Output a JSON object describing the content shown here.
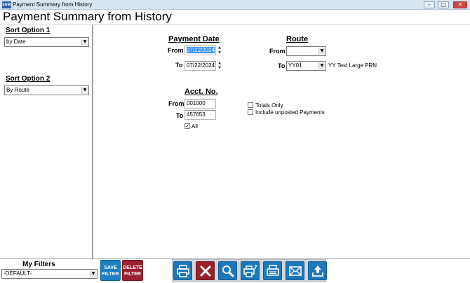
{
  "window": {
    "title": "Payment Summary from History",
    "app_icon": "ssw"
  },
  "page_title": "Payment Summary from History",
  "sort_option_1": {
    "label": "Sort Option 1",
    "value": "by Date"
  },
  "sort_option_2": {
    "label": "Sort Option 2",
    "value": "By Route"
  },
  "payment_date": {
    "header": "Payment Date",
    "from_label": "From",
    "from_value": "07/22/2024",
    "to_label": "To",
    "to_value": "07/22/2024"
  },
  "route": {
    "header": "Route",
    "from_label": "From",
    "from_value": "",
    "to_label": "To",
    "to_value": "YY01",
    "to_description": "YY Test Large PRN"
  },
  "acct_no": {
    "header": "Acct. No.",
    "from_label": "From",
    "from_value": "001000",
    "to_label": "To",
    "to_value": "457653",
    "all_label": "All",
    "all_checked": true
  },
  "options": {
    "totals_only": {
      "label": "Totals Only",
      "checked": false
    },
    "include_unposted": {
      "label": "Include unposted Payments",
      "checked": false
    }
  },
  "filters": {
    "label": "My Filters",
    "value": "-DEFAULT-",
    "save_line1": "SAVE",
    "save_line2": "FILTER",
    "delete_line1": "DELETE",
    "delete_line2": "FILTER"
  },
  "toolbar_icons": [
    "print-icon",
    "cancel-icon",
    "preview-icon",
    "print-setup-icon",
    "fax-icon",
    "email-icon",
    "export-icon"
  ],
  "colors": {
    "button_blue": "#1b78bd",
    "button_red": "#98202a",
    "selection_blue": "#3390ff"
  }
}
